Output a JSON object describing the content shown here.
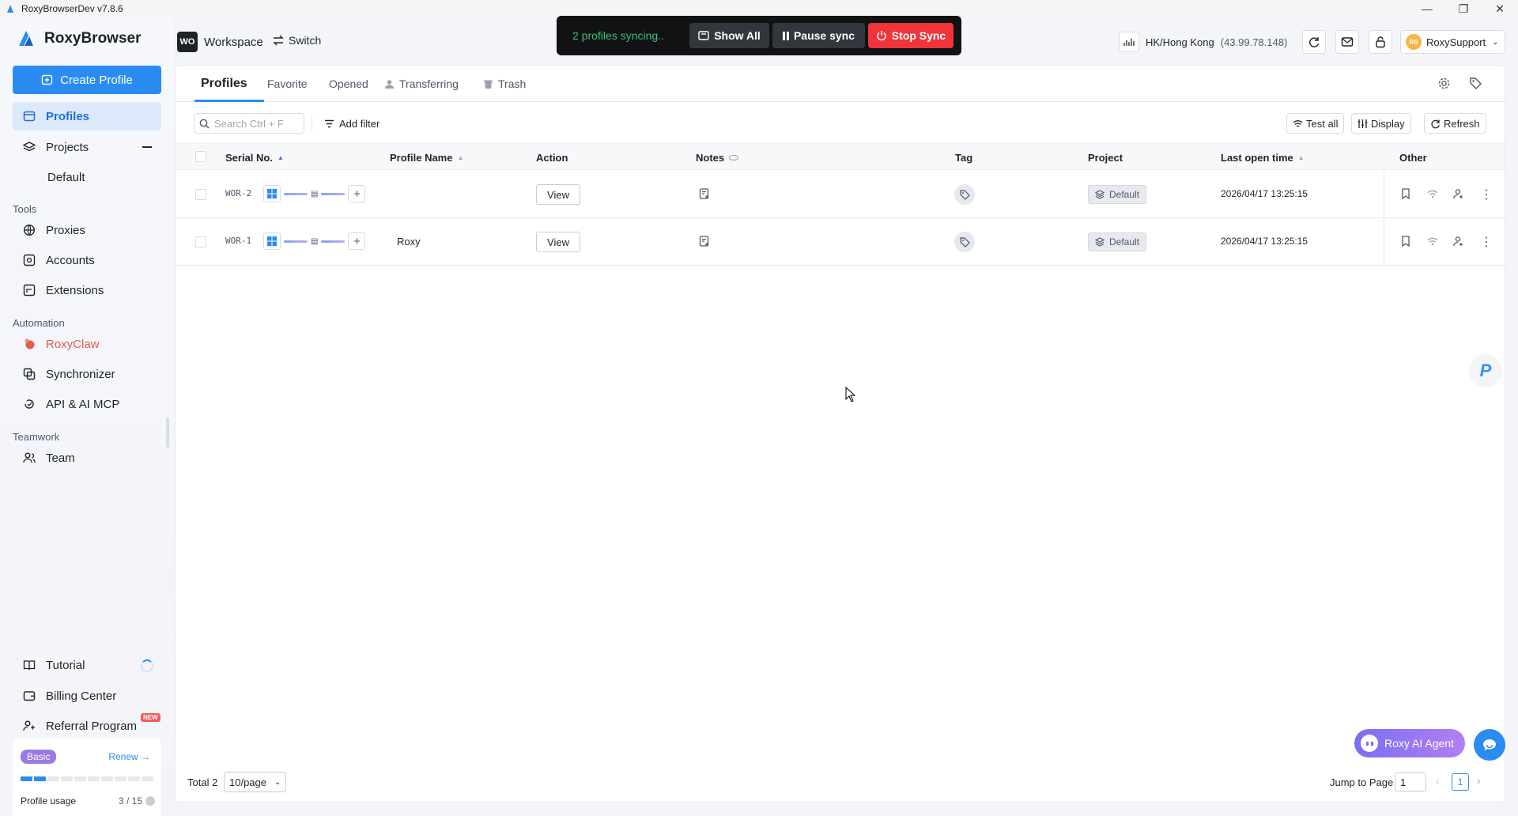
{
  "window": {
    "title": "RoxyBrowserDev v7.8.6"
  },
  "sidebar": {
    "brand": "RoxyBrowser",
    "create_label": "Create Profile",
    "items": {
      "profiles": "Profiles",
      "projects": "Projects",
      "default": "Default",
      "proxies": "Proxies",
      "accounts": "Accounts",
      "extensions": "Extensions",
      "roxyclaw": "RoxyClaw",
      "synchronizer": "Synchronizer",
      "api": "API & AI MCP",
      "team": "Team",
      "tutorial": "Tutorial",
      "billing": "Billing Center",
      "referral": "Referral Program"
    },
    "sections": {
      "tools": "Tools",
      "automation": "Automation",
      "teamwork": "Teamwork"
    },
    "new_badge": "NEW",
    "plan": {
      "name": "Basic",
      "renew": "Renew →",
      "usage_label": "Profile usage",
      "usage_count": "3 / 15",
      "usage_fraction": 0.2
    }
  },
  "header": {
    "workspace_initials": "WO",
    "workspace": "Workspace",
    "switch": "Switch",
    "sync_status": "2 profiles syncing..",
    "show_all": "Show All",
    "pause_sync": "Pause sync",
    "stop_sync": "Stop Sync",
    "proxy_location": "HK/Hong Kong",
    "proxy_ip": "(43.99.78.148)",
    "user_initials": "RS",
    "user": "RoxySupport"
  },
  "tabs": [
    "Profiles",
    "Favorite",
    "Opened",
    "Transferring",
    "Trash"
  ],
  "toolbar": {
    "search_placeholder": "Search Ctrl + F",
    "add_filter": "Add filter",
    "test_all": "Test all",
    "display": "Display",
    "refresh": "Refresh"
  },
  "table": {
    "columns": [
      "Serial No.",
      "Profile Name",
      "Action",
      "Notes",
      "Tag",
      "Project",
      "Last open time",
      "Other"
    ],
    "rows": [
      {
        "serial": "WOR-2",
        "name": "",
        "action": "View",
        "project": "Default",
        "last_open": "2026/04/17 13:25:15"
      },
      {
        "serial": "WOR-1",
        "name": "Roxy",
        "action": "View",
        "project": "Default",
        "last_open": "2026/04/17 13:25:15"
      }
    ]
  },
  "footer": {
    "total": "Total 2",
    "page_size": "10/page",
    "jump_label": "Jump to Page",
    "jump_value": "1",
    "current_page": "1"
  },
  "ai_agent": "Roxy AI Agent",
  "colors": {
    "accent": "#2a8cf3",
    "stop": "#f1343a",
    "sync_text": "#3ec07a",
    "roxyclaw": "#e85a4f"
  }
}
